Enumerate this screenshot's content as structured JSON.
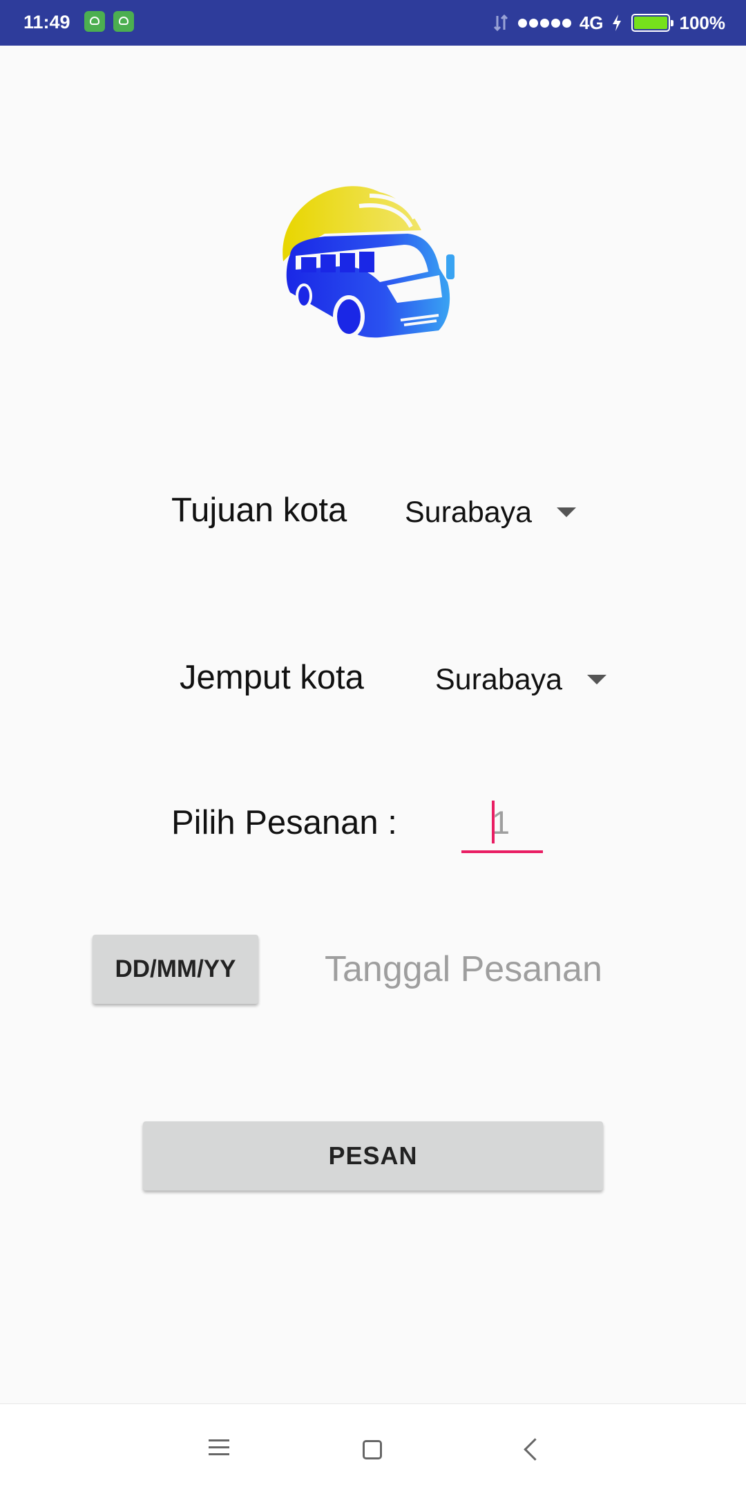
{
  "status_bar": {
    "time": "11:49",
    "network": "4G",
    "battery": "100%",
    "battery_level": 1.0,
    "icons": [
      "app-notification-icon",
      "app-notification-icon",
      "data-transfer-icon",
      "signal-dots-icon",
      "charging-icon",
      "battery-icon"
    ]
  },
  "logo": {
    "icon": "bus-logo-icon",
    "colors": {
      "sun": "#e8d600",
      "bus": "#1e3cf0"
    }
  },
  "form": {
    "destination": {
      "label": "Tujuan kota",
      "value": "Surabaya"
    },
    "pickup": {
      "label": "Jemput kota",
      "value": "Surabaya"
    },
    "quantity": {
      "label": "Pilih Pesanan :",
      "value": "1"
    },
    "date": {
      "button_label": "DD/MM/YY",
      "hint": "Tanggal Pesanan"
    },
    "submit_label": "PESAN"
  },
  "colors": {
    "status_bar": "#2e3c9b",
    "accent": "#e91e63",
    "button": "#d6d7d7"
  },
  "nav_bar": {
    "icons": [
      "menu-icon",
      "home-icon",
      "back-icon"
    ]
  }
}
